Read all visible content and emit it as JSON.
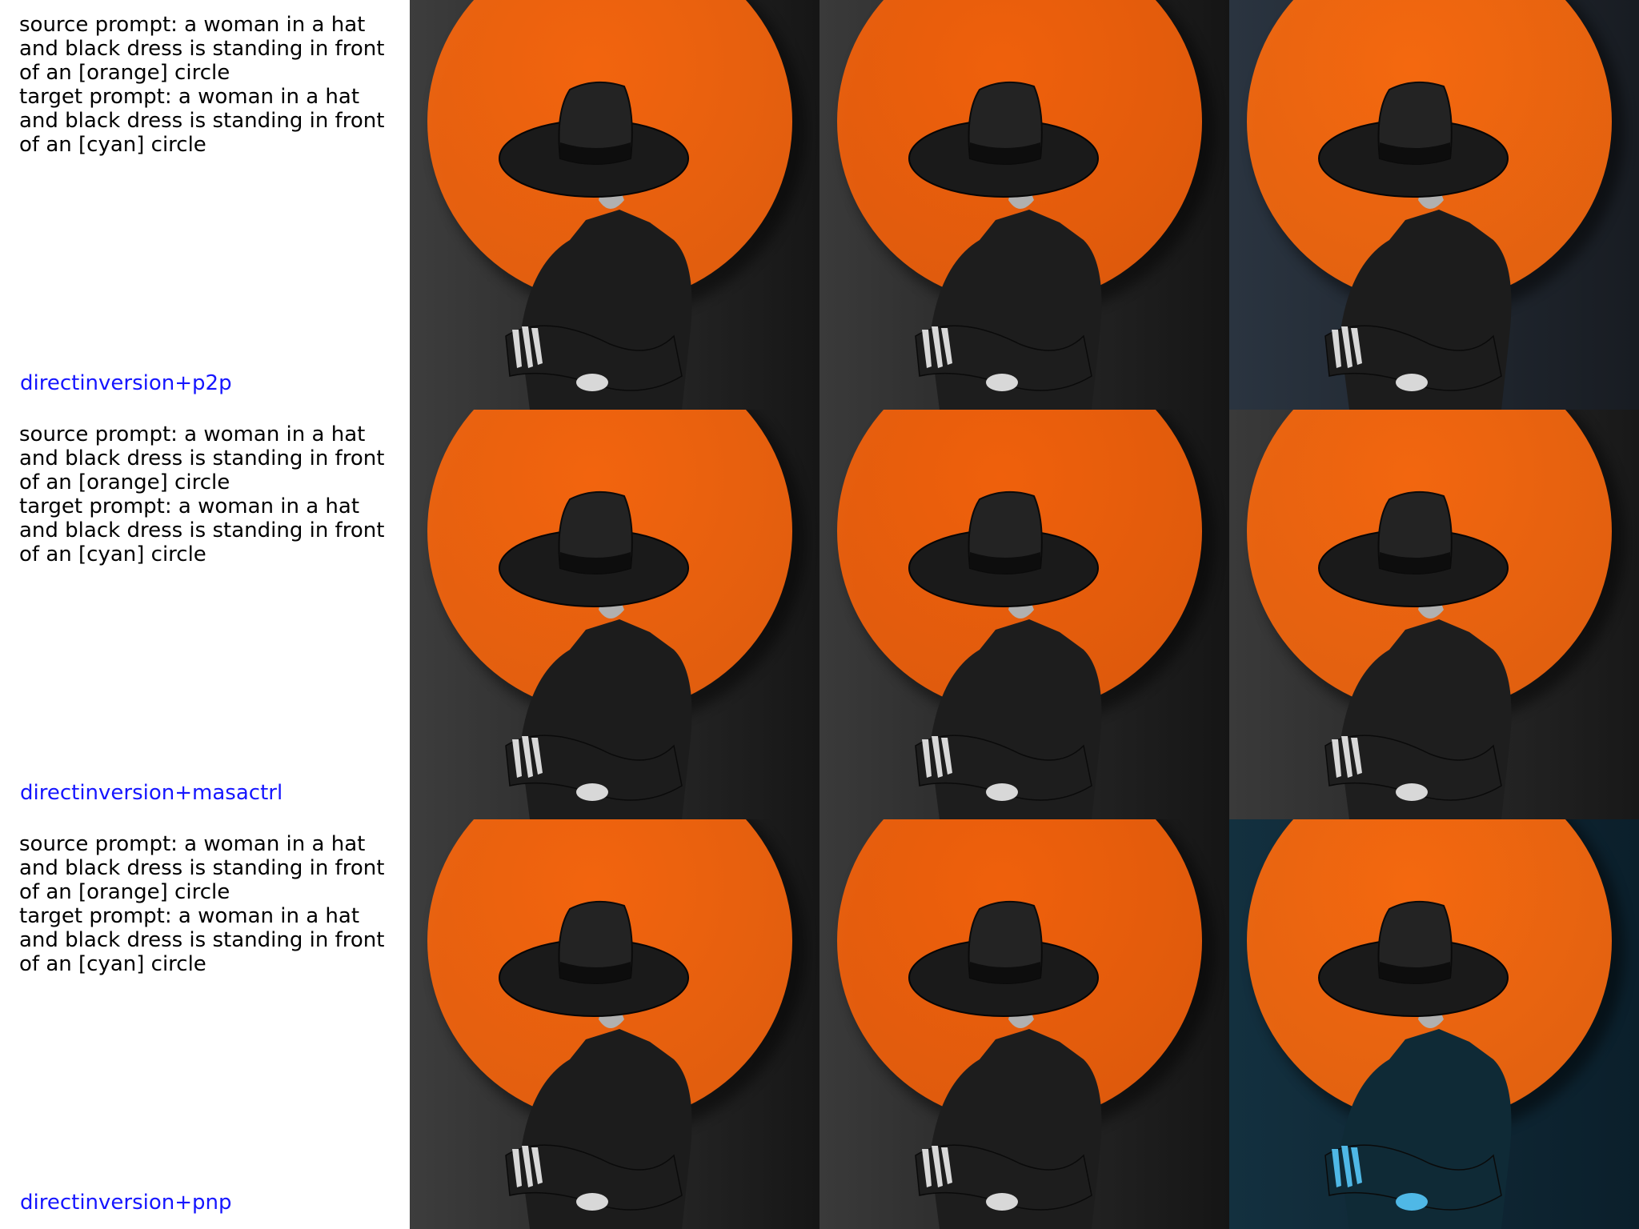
{
  "rows": [
    {
      "source_prompt": "source prompt: a woman in a hat and black dress is standing in front of an [orange] circle",
      "target_prompt": "target prompt: a woman in a hat and black dress is standing in front of an [cyan] circle",
      "method": "directinversion+p2p",
      "images": [
        {
          "circle": "#f2640e",
          "bg_left": "#3d3d3d",
          "bg_right": "#161616",
          "figure": "#1c1c1c",
          "hand": "#d8d8d8"
        },
        {
          "circle": "#ef600c",
          "bg_left": "#3a3a3a",
          "bg_right": "#151515",
          "figure": "#1d1d1d",
          "hand": "#d8d8d8"
        },
        {
          "circle": "#f4680f",
          "bg_left": "#2a3440",
          "bg_right": "#181c22",
          "figure": "#1c1c1c",
          "hand": "#d8d8d8"
        }
      ]
    },
    {
      "source_prompt": "source prompt: a woman in a hat and black dress is standing in front of an [orange] circle",
      "target_prompt": "target prompt: a woman in a hat and black dress is standing in front of an [cyan] circle",
      "method": "directinversion+masactrl",
      "images": [
        {
          "circle": "#f2640e",
          "bg_left": "#3d3d3d",
          "bg_right": "#161616",
          "figure": "#1c1c1c",
          "hand": "#d8d8d8"
        },
        {
          "circle": "#ef600c",
          "bg_left": "#3a3a3a",
          "bg_right": "#151515",
          "figure": "#1d1d1d",
          "hand": "#d8d8d8"
        },
        {
          "circle": "#f2660f",
          "bg_left": "#3a3a3a",
          "bg_right": "#181818",
          "figure": "#1e1e1e",
          "hand": "#d8d8d8"
        }
      ]
    },
    {
      "source_prompt": "source prompt: a woman in a hat and black dress is standing in front of an [orange] circle",
      "target_prompt": "target prompt: a woman in a hat and black dress is standing in front of an [cyan] circle",
      "method": "directinversion+pnp",
      "images": [
        {
          "circle": "#f2640e",
          "bg_left": "#3d3d3d",
          "bg_right": "#161616",
          "figure": "#1c1c1c",
          "hand": "#d8d8d8"
        },
        {
          "circle": "#ef600c",
          "bg_left": "#3a3a3a",
          "bg_right": "#151515",
          "figure": "#1d1d1d",
          "hand": "#d8d8d8"
        },
        {
          "circle": "#f4680f",
          "bg_left": "#13303f",
          "bg_right": "#0b1f2b",
          "figure": "#0f2a36",
          "hand": "#4fb8e6"
        }
      ]
    }
  ]
}
